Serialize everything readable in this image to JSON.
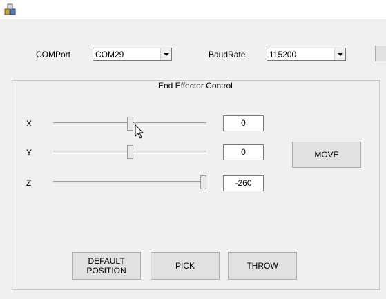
{
  "window": {
    "app_icon": "app-cube-icon"
  },
  "connection": {
    "com_label": "COMPort",
    "com_value": "COM29",
    "baud_label": "BaudRate",
    "baud_value": "115200"
  },
  "group": {
    "title": "End Effector Control",
    "axes": [
      {
        "label": "X",
        "value": "0",
        "slider_fraction": 0.5
      },
      {
        "label": "Y",
        "value": "0",
        "slider_fraction": 0.5
      },
      {
        "label": "Z",
        "value": "-260",
        "slider_fraction": 1.0
      }
    ],
    "move_label": "MOVE",
    "default_label": "DEFAULT\nPOSITION",
    "pick_label": "PICK",
    "throw_label": "THROW"
  },
  "icons": {
    "cursor": "mouse-pointer-icon",
    "dropdown": "dropdown-arrow-icon"
  }
}
